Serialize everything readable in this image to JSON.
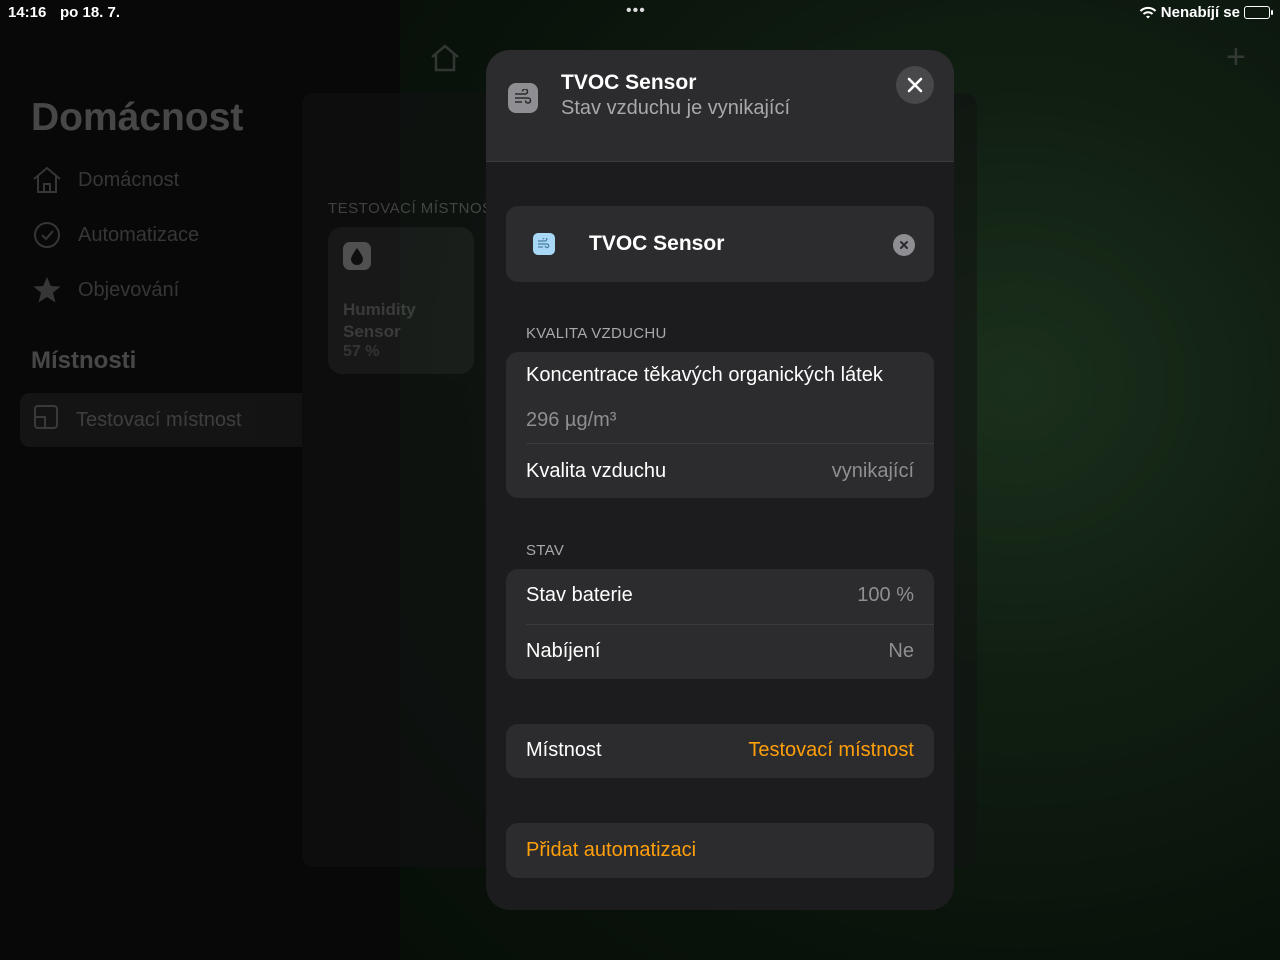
{
  "status_bar": {
    "time": "14:16",
    "date": "po 18. 7.",
    "dots": "•••",
    "charging_text": "Nenabíjí se"
  },
  "sidebar": {
    "title": "Domácnost",
    "items": [
      {
        "label": "Domácnost",
        "icon": "home-icon"
      },
      {
        "label": "Automatizace",
        "icon": "clock-icon"
      },
      {
        "label": "Objevování",
        "icon": "star-icon"
      }
    ],
    "rooms_title": "Místnosti",
    "rooms": [
      {
        "label": "Testovací místnost",
        "icon": "room-icon"
      }
    ]
  },
  "room_panel": {
    "label": "TESTOVACÍ MÍSTNOST",
    "tile": {
      "name_line1": "Humidity",
      "name_line2": "Sensor",
      "value": "57 %",
      "icon": "drop-icon"
    }
  },
  "modal": {
    "header": {
      "title": "TVOC Sensor",
      "subtitle": "Stav vzduchu je vynikající",
      "icon": "air-quality-icon"
    },
    "name_field": {
      "value": "TVOC Sensor"
    },
    "air_quality": {
      "label": "KVALITA VZDUCHU",
      "concentration_label": "Koncentrace těkavých organických látek",
      "concentration_value": "296 µg/m³",
      "quality_label": "Kvalita vzduchu",
      "quality_value": "vynikající"
    },
    "status": {
      "label": "STAV",
      "battery_label": "Stav baterie",
      "battery_value": "100 %",
      "charging_label": "Nabíjení",
      "charging_value": "Ne"
    },
    "room": {
      "label": "Místnost",
      "value": "Testovací místnost"
    },
    "add_automation_label": "Přidat automatizaci"
  },
  "colors": {
    "accent": "#ff9f0a",
    "card": "#2c2c2e",
    "modal": "#1c1c1e"
  }
}
